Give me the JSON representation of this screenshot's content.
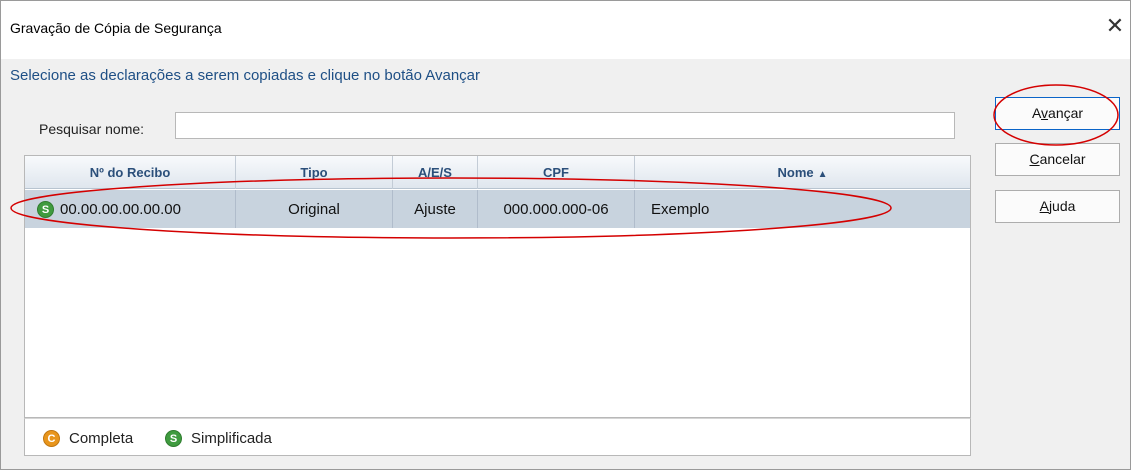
{
  "window": {
    "title": "Gravação de Cópia de Segurança",
    "close_glyph": "✕"
  },
  "instruction": "Selecione as declarações a serem copiadas e clique no botão Avançar",
  "search": {
    "label": "Pesquisar nome:",
    "value": "",
    "placeholder": ""
  },
  "table": {
    "columns": [
      "Nº do Recibo",
      "Tipo",
      "A/E/S",
      "CPF",
      "Nome"
    ],
    "sorted_column": "Nome",
    "sort_direction": "ascending",
    "rows": [
      {
        "badge": "S",
        "recibo": "00.00.00.00.00.00",
        "tipo": "Original",
        "aes": "Ajuste",
        "cpf": "000.000.000-06",
        "nome": "Exemplo",
        "selected": true
      }
    ]
  },
  "legend": {
    "completa": {
      "icon": "C",
      "label": "Completa",
      "color": "#e8951c"
    },
    "simplificada": {
      "icon": "S",
      "label": "Simplificada",
      "color": "#3f9b3f"
    }
  },
  "buttons": {
    "avancar": {
      "label": "Avançar",
      "mnemonic": "v"
    },
    "cancelar": {
      "label": "Cancelar",
      "mnemonic": "C"
    },
    "ajuda": {
      "label": "Ajuda",
      "mnemonic": "A"
    }
  },
  "colors": {
    "instruction": "#1e4f85",
    "header_text": "#2b4f7a",
    "selected_row": "#c8d3de",
    "annotation": "#d40000"
  }
}
